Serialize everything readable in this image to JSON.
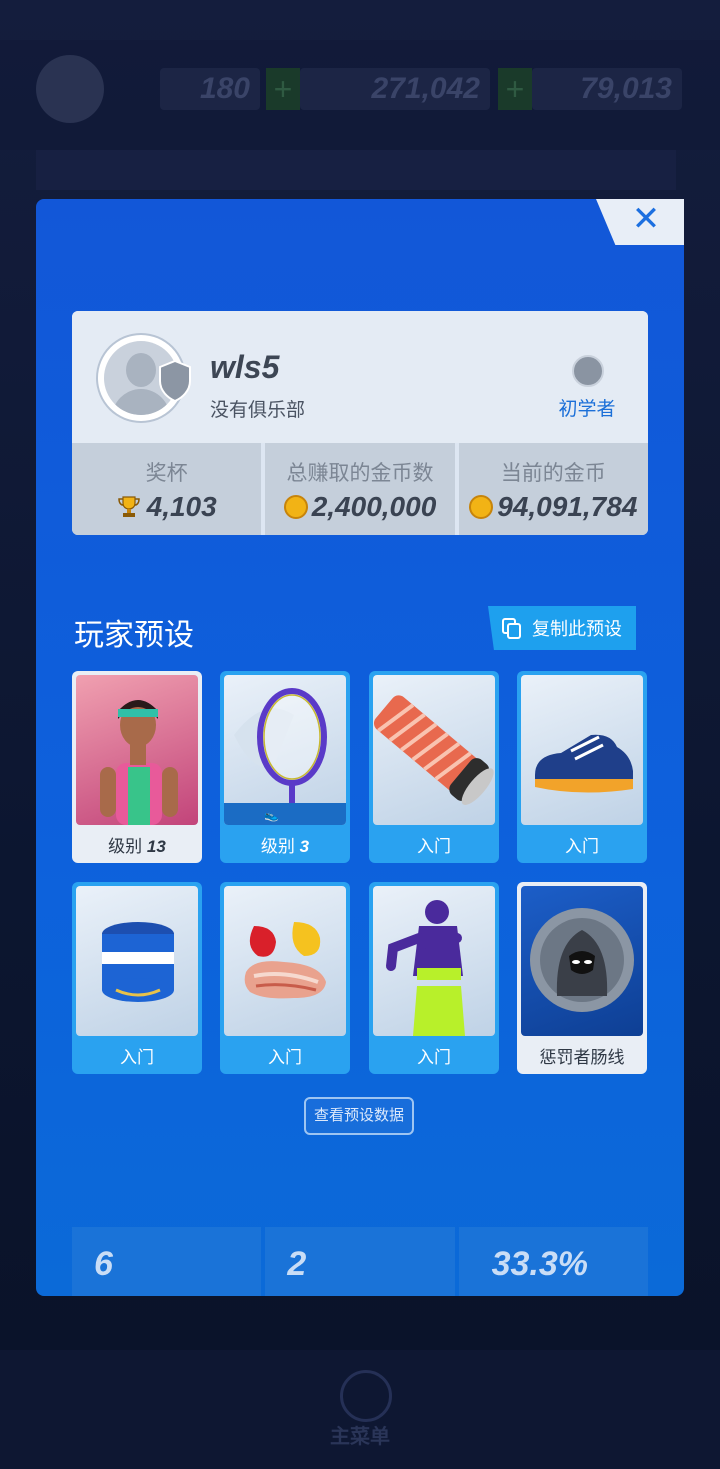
{
  "background": {
    "stats": [
      "180",
      "271,042",
      "79,013"
    ],
    "menu_label": "主菜单"
  },
  "profile": {
    "username": "wls5",
    "club": "没有俱乐部",
    "rank": "初学者",
    "stats": [
      {
        "label": "奖杯",
        "value": "4,103",
        "icon": "trophy-icon"
      },
      {
        "label": "总赚取的金币数",
        "value": "2,400,000",
        "icon": "coin-icon"
      },
      {
        "label": "当前的金币",
        "value": "94,091,784",
        "icon": "coin-icon"
      }
    ]
  },
  "preset": {
    "title": "玩家预设",
    "copy_label": "复制此预设",
    "view_label": "查看预设数据",
    "cards": [
      {
        "label_prefix": "级别",
        "label_num": "13",
        "kind": "player-character"
      },
      {
        "label_prefix": "级别",
        "label_num": "3",
        "kind": "racket"
      },
      {
        "label_prefix": "入门",
        "label_num": "",
        "kind": "grip"
      },
      {
        "label_prefix": "入门",
        "label_num": "",
        "kind": "shoe"
      },
      {
        "label_prefix": "入门",
        "label_num": "",
        "kind": "wristband"
      },
      {
        "label_prefix": "入门",
        "label_num": "",
        "kind": "nutrition"
      },
      {
        "label_prefix": "入门",
        "label_num": "",
        "kind": "workout"
      },
      {
        "label_prefix": "惩罚者肠线",
        "label_num": "",
        "kind": "string"
      }
    ]
  },
  "bottom_stats": [
    "6",
    "2",
    "33.3%"
  ],
  "colors": {
    "panel": "#1257d8",
    "accent": "#1ea0ee",
    "coin": "#f2b315"
  }
}
